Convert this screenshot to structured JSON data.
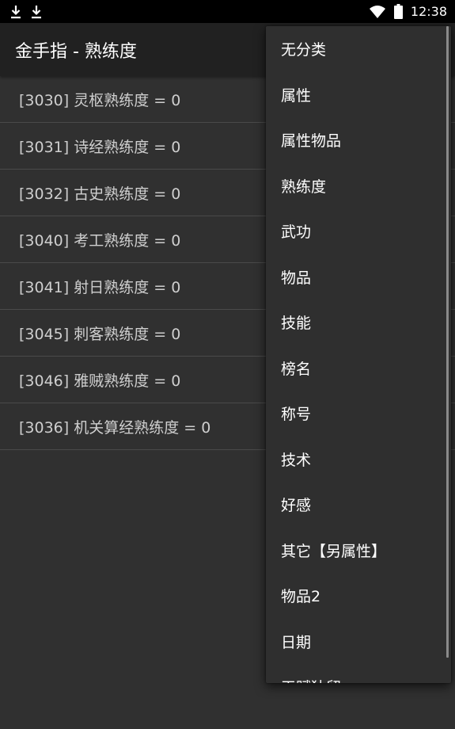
{
  "status_bar": {
    "time": "12:38",
    "icons": [
      "download-icon",
      "download-icon",
      "wifi-icon",
      "battery-icon"
    ]
  },
  "app_bar": {
    "title": "金手指 - 熟练度"
  },
  "list": {
    "items": [
      "[3030] 灵枢熟练度 = 0",
      "[3031] 诗经熟练度 = 0",
      "[3032] 古史熟练度 = 0",
      "[3040] 考工熟练度 = 0",
      "[3041] 射日熟练度 = 0",
      "[3045] 刺客熟练度 = 0",
      "[3046] 雅贼熟练度 = 0",
      "[3036] 机关算经熟练度 = 0"
    ]
  },
  "menu": {
    "items": [
      "无分类",
      "属性",
      "属性物品",
      "熟练度",
      "武功",
      "物品",
      "技能",
      "榜名",
      "称号",
      "技术",
      "好感",
      "其它【另属性】",
      "物品2",
      "日期",
      "天赋独留"
    ]
  },
  "colors": {
    "status_bar_bg": "#000000",
    "app_bar_bg": "#212121",
    "page_bg": "#303030",
    "menu_bg": "#2f2f2f",
    "list_text": "#cfcfcf",
    "divider": "#4a4a4a"
  }
}
